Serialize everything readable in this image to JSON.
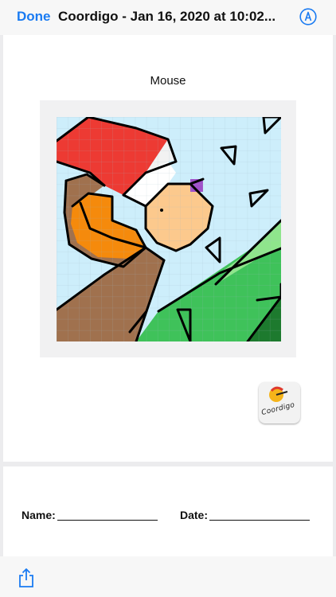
{
  "nav": {
    "done_label": "Done",
    "document_title": "Coordigo - Jan 16, 2020 at 10:02...",
    "markup_icon": "markup-pen-icon"
  },
  "worksheet": {
    "title": "Mouse",
    "logo_text": "Coordigo"
  },
  "form": {
    "name_label": "Name:",
    "date_label": "Date:"
  },
  "toolbar": {
    "share_icon": "share-icon"
  },
  "colors": {
    "accent": "#1a7bf2",
    "sky": "#cdeefb",
    "red": "#ed3a33",
    "brown": "#a0714e",
    "orange": "#f58a0c",
    "face": "#fcc98d",
    "purple": "#a04fc9",
    "green": "#3fc25a",
    "light_green": "#8fe58c",
    "dark_green": "#1d7a2e"
  }
}
